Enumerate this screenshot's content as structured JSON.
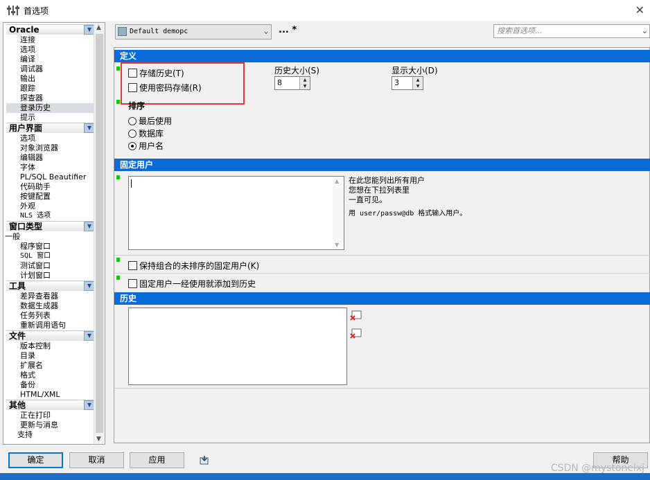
{
  "window": {
    "title": "首选项",
    "close_glyph": "✕"
  },
  "sidebar": {
    "groups": [
      {
        "label": "Oracle",
        "items": [
          "连接",
          "选项",
          "编译",
          "调试器",
          "输出",
          "跟踪",
          "探查器",
          "登录历史",
          "提示"
        ]
      },
      {
        "label": "用户界面",
        "items": [
          "选项",
          "对象浏览器",
          "编辑器",
          "字体",
          "PL/SQL Beautifier",
          "代码助手",
          "按键配置",
          "外观",
          "NLS 选项"
        ]
      },
      {
        "label": "窗口类型",
        "items": [
          "一般",
          "程序窗口",
          "SQL 窗口",
          "测试窗口",
          "计划窗口"
        ]
      },
      {
        "label": "工具",
        "items": [
          "差异查看器",
          "数据生成器",
          "任务列表",
          "重新调用语句"
        ]
      },
      {
        "label": "文件",
        "items": [
          "版本控制",
          "目录",
          "扩展名",
          "格式",
          "备份",
          "HTML/XML"
        ]
      },
      {
        "label": "其他",
        "items": [
          "正在打印",
          "更新与消息",
          "支持"
        ]
      }
    ],
    "selected": "登录历史"
  },
  "toolbar": {
    "profile": "Default demopc",
    "more": "... *",
    "search_placeholder": "搜索首选项..."
  },
  "sections": {
    "definition": {
      "title": "定义",
      "store_history": "存储历史(T)",
      "use_password": "使用密码存储(R)",
      "history_size_label": "历史大小(S)",
      "history_size_value": "8",
      "display_size_label": "显示大小(D)",
      "display_size_value": "3",
      "sort_label": "排序",
      "sort_options": [
        "最后使用",
        "数据库",
        "用户名"
      ],
      "sort_selected": "用户名"
    },
    "fixed_users": {
      "title": "固定用户",
      "help_lines": [
        "在此您能列出所有用户",
        "您想在下拉列表里",
        "一直可见。"
      ],
      "format_hint": "用 user/passw@db 格式输入用户。",
      "keep_unsorted": "保持组合的未排序的固定用户(K)",
      "add_to_history": "固定用户一经使用就添加到历史"
    },
    "history": {
      "title": "历史"
    }
  },
  "buttons": {
    "ok": "确定",
    "cancel": "取消",
    "apply": "应用",
    "help": "帮助"
  },
  "watermark": "CSDN @mystonelxj",
  "colors": {
    "section_bar": "#0a6ad8",
    "marker": "#16c60c",
    "highlight": "#e33333"
  }
}
